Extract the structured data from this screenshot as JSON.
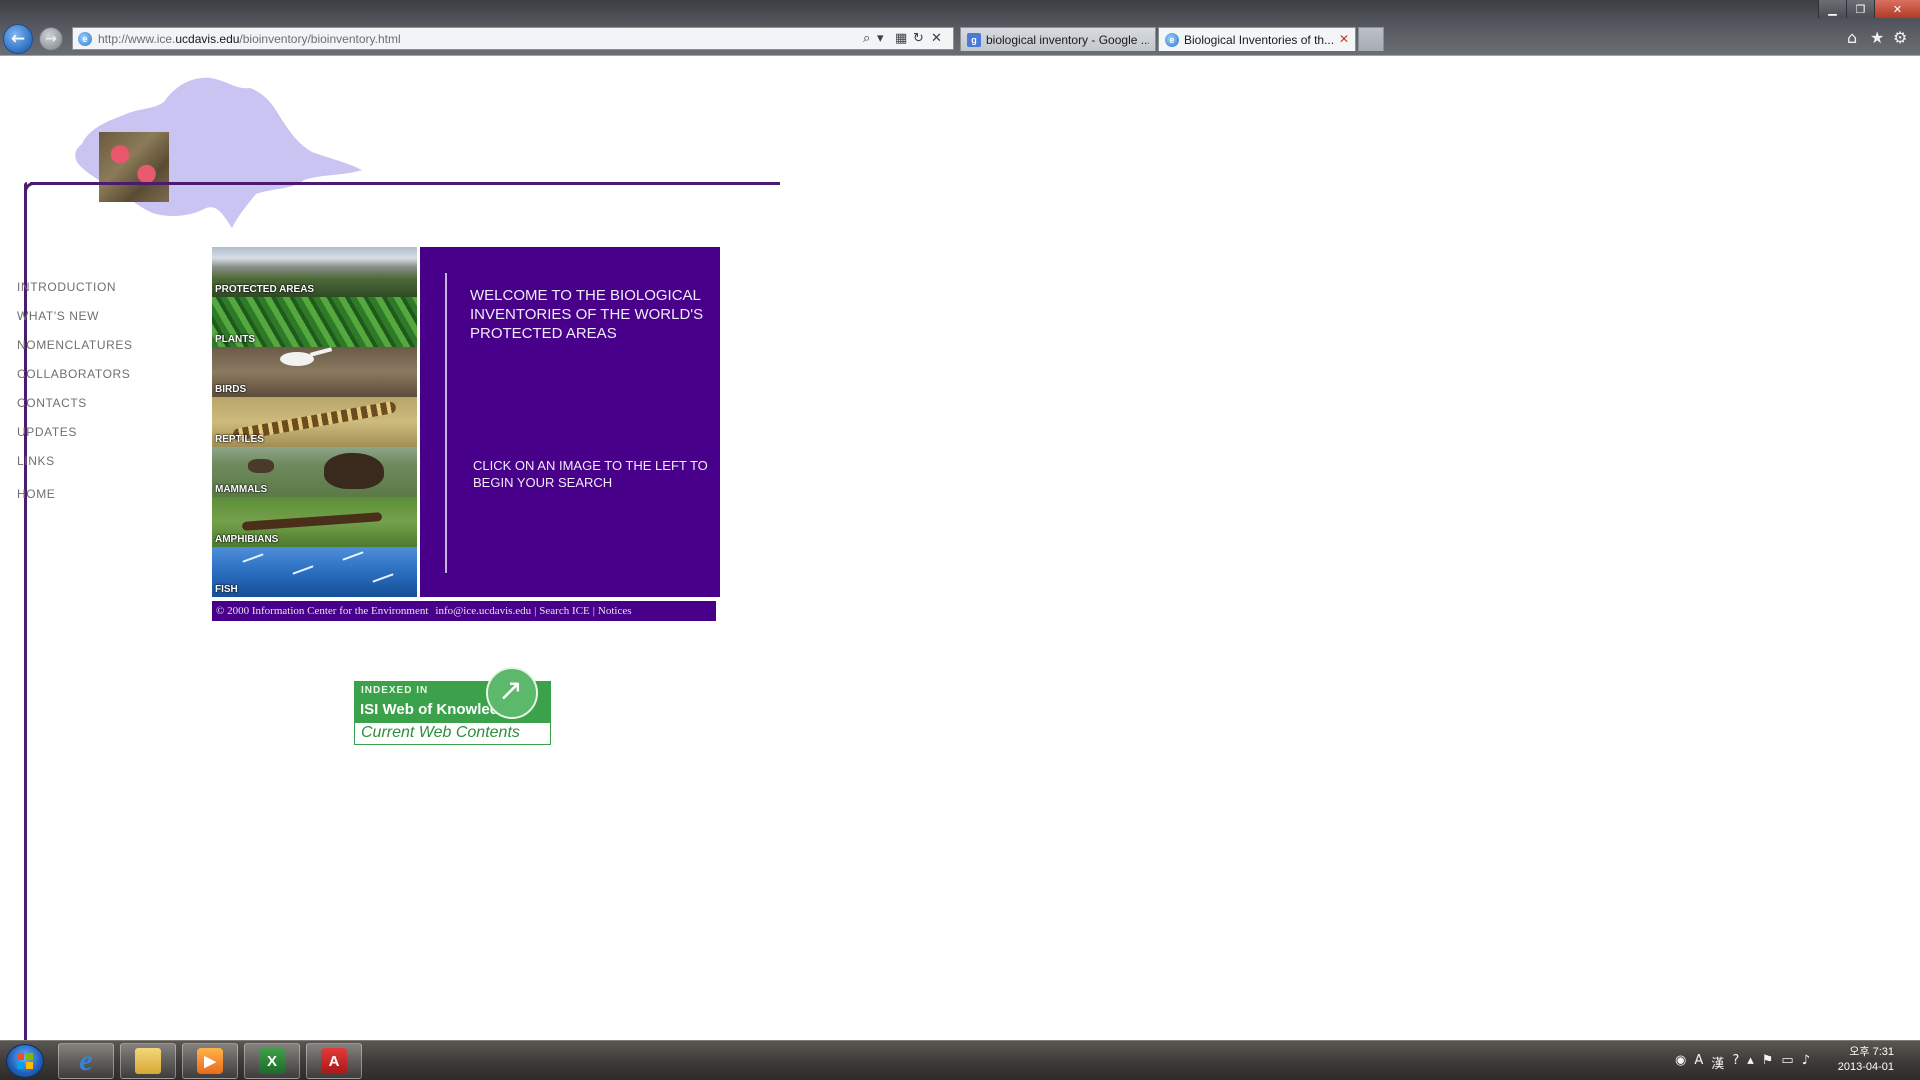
{
  "browser": {
    "address_url_prefix": "http://www.ice.",
    "address_url_domain": "ucdavis.edu",
    "address_url_path": "/bioinventory/bioinventory.html",
    "tabs": [
      {
        "label": "biological inventory - Google ..."
      },
      {
        "label": "Biological Inventories of th..."
      }
    ],
    "icons": {
      "back": "arrow-left-icon",
      "forward": "arrow-right-icon",
      "home": "home-icon",
      "favorites": "star-icon",
      "tools": "gear-icon"
    }
  },
  "nav": {
    "items": [
      "INTRODUCTION",
      "WHAT'S NEW",
      "NOMENCLATURES",
      "COLLABORATORS",
      "CONTACTS",
      "UPDATES",
      "LINKS"
    ],
    "home": "HOME"
  },
  "categories": [
    {
      "label": "PROTECTED AREAS"
    },
    {
      "label": "PLANTS"
    },
    {
      "label": "BIRDS"
    },
    {
      "label": "REPTILES"
    },
    {
      "label": "MAMMALS"
    },
    {
      "label": "AMPHIBIANS"
    },
    {
      "label": "FISH"
    }
  ],
  "welcome": {
    "title": "WELCOME TO THE BIOLOGICAL INVENTORIES OF THE WORLD'S PROTECTED AREAS",
    "instruction": "CLICK ON AN IMAGE TO THE LEFT TO BEGIN YOUR SEARCH"
  },
  "footer": {
    "copyright": "© 2000 Information Center for the Environment",
    "email": "info@ice.ucdavis.edu",
    "sep": "|",
    "search": "Search ICE",
    "notices": "Notices"
  },
  "isi_badge": {
    "indexed_in": "INDEXED IN",
    "name": "ISI Web of Knowledge℠",
    "subtitle": "Current Web Contents"
  },
  "taskbar": {
    "clock_time": "오후 7:31",
    "clock_date": "2013-04-01"
  },
  "colors": {
    "accent_purple": "#48008a",
    "line_purple": "#4b1b6e",
    "isi_green": "#3ba24b"
  }
}
